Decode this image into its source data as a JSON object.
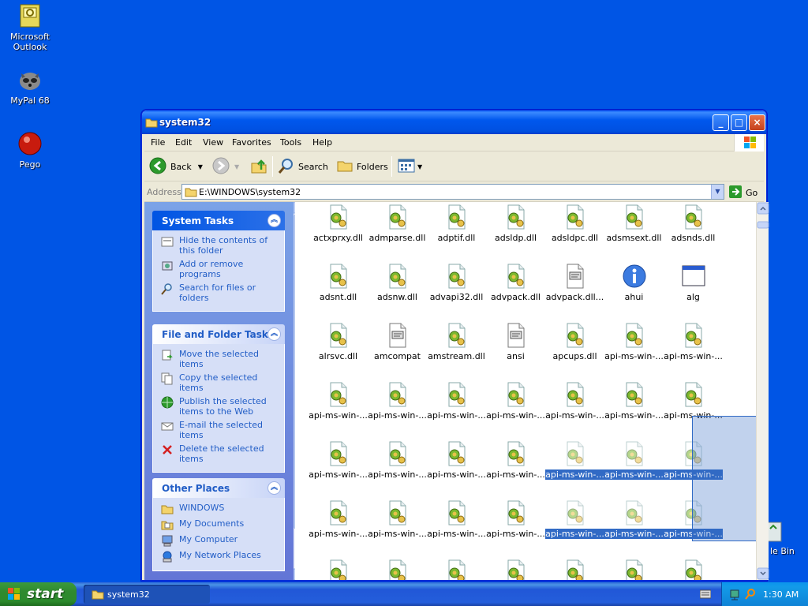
{
  "desktop": {
    "icons": [
      {
        "label": "Microsoft Outlook"
      },
      {
        "label": "MyPal 68"
      },
      {
        "label": "Pego"
      },
      {
        "label": "le Bin"
      }
    ]
  },
  "window": {
    "title": "system32",
    "menu": [
      "File",
      "Edit",
      "View",
      "Favorites",
      "Tools",
      "Help"
    ],
    "toolbar": {
      "back": "Back",
      "search": "Search",
      "folders": "Folders"
    },
    "address": {
      "label": "Address",
      "value": "E:\\WINDOWS\\system32",
      "go": "Go"
    }
  },
  "tasks": {
    "system": {
      "title": "System Tasks",
      "items": [
        "Hide the contents of this folder",
        "Add or remove programs",
        "Search for files or folders"
      ]
    },
    "file_folder": {
      "title": "File and Folder Tasks",
      "items": [
        "Move the selected items",
        "Copy the selected items",
        "Publish the selected items to the Web",
        "E-mail the selected items",
        "Delete the selected items"
      ]
    },
    "other": {
      "title": "Other Places",
      "items": [
        "WINDOWS",
        "My Documents",
        "My Computer",
        "My Network Places"
      ]
    }
  },
  "files": [
    {
      "name": "actxprxy.dll",
      "icon": "dll"
    },
    {
      "name": "admparse.dll",
      "icon": "dll"
    },
    {
      "name": "adptif.dll",
      "icon": "dll"
    },
    {
      "name": "adsldp.dll",
      "icon": "dll"
    },
    {
      "name": "adsldpc.dll",
      "icon": "dll"
    },
    {
      "name": "adsmsext.dll",
      "icon": "dll"
    },
    {
      "name": "adsnds.dll",
      "icon": "dll"
    },
    {
      "name": "adsnt.dll",
      "icon": "dll"
    },
    {
      "name": "adsnw.dll",
      "icon": "dll"
    },
    {
      "name": "advapi32.dll",
      "icon": "dll"
    },
    {
      "name": "advpack.dll",
      "icon": "dll"
    },
    {
      "name": "advpack.dll...",
      "icon": "text"
    },
    {
      "name": "ahui",
      "icon": "info"
    },
    {
      "name": "alg",
      "icon": "window"
    },
    {
      "name": "alrsvc.dll",
      "icon": "dll"
    },
    {
      "name": "amcompat",
      "icon": "text"
    },
    {
      "name": "amstream.dll",
      "icon": "dll"
    },
    {
      "name": "ansi",
      "icon": "text"
    },
    {
      "name": "apcups.dll",
      "icon": "dll"
    },
    {
      "name": "api-ms-win-...",
      "icon": "dll"
    },
    {
      "name": "api-ms-win-...",
      "icon": "dll"
    },
    {
      "name": "api-ms-win-...",
      "icon": "dll"
    },
    {
      "name": "api-ms-win-...",
      "icon": "dll"
    },
    {
      "name": "api-ms-win-...",
      "icon": "dll"
    },
    {
      "name": "api-ms-win-...",
      "icon": "dll"
    },
    {
      "name": "api-ms-win-...",
      "icon": "dll"
    },
    {
      "name": "api-ms-win-...",
      "icon": "dll"
    },
    {
      "name": "api-ms-win-...",
      "icon": "dll"
    },
    {
      "name": "api-ms-win-...",
      "icon": "dll"
    },
    {
      "name": "api-ms-win-...",
      "icon": "dll"
    },
    {
      "name": "api-ms-win-...",
      "icon": "dll"
    },
    {
      "name": "api-ms-win-...",
      "icon": "dll"
    },
    {
      "name": "api-ms-win-...",
      "icon": "dll",
      "selected": true
    },
    {
      "name": "api-ms-win-...",
      "icon": "dll",
      "selected": true
    },
    {
      "name": "api-ms-win-...",
      "icon": "dll",
      "selected": true
    },
    {
      "name": "api-ms-win-...",
      "icon": "dll"
    },
    {
      "name": "api-ms-win-...",
      "icon": "dll"
    },
    {
      "name": "api-ms-win-...",
      "icon": "dll"
    },
    {
      "name": "api-ms-win-...",
      "icon": "dll"
    },
    {
      "name": "api-ms-win-...",
      "icon": "dll",
      "selected": true
    },
    {
      "name": "api-ms-win-...",
      "icon": "dll",
      "selected": true
    },
    {
      "name": "api-ms-win-...",
      "icon": "dll",
      "selected": true
    },
    {
      "name": "",
      "icon": "dll"
    },
    {
      "name": "",
      "icon": "dll"
    },
    {
      "name": "",
      "icon": "dll"
    },
    {
      "name": "",
      "icon": "dll"
    },
    {
      "name": "",
      "icon": "dll"
    },
    {
      "name": "",
      "icon": "dll"
    },
    {
      "name": "",
      "icon": "dll"
    }
  ],
  "taskbar": {
    "start": "start",
    "task": "system32",
    "clock": "1:30 AM"
  }
}
